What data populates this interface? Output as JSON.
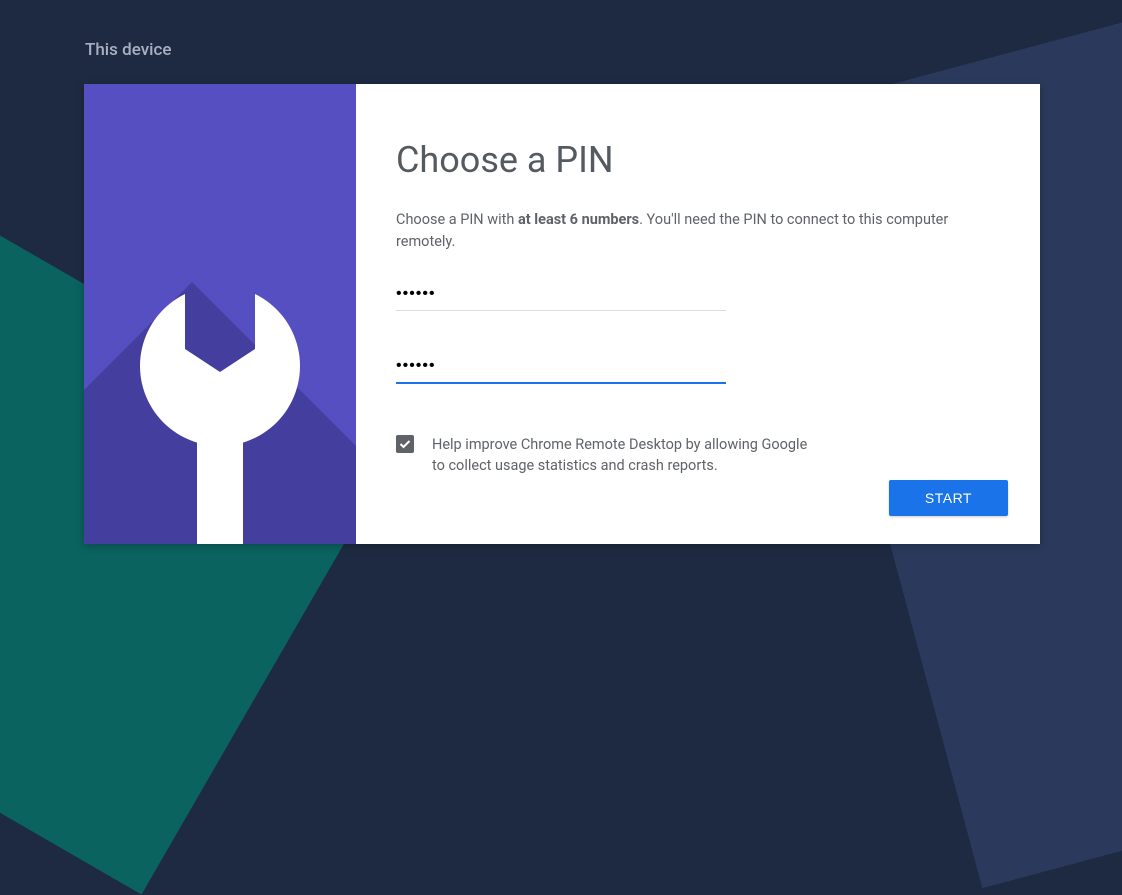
{
  "page": {
    "section_label": "This device"
  },
  "dialog": {
    "title": "Choose a PIN",
    "desc_pre": "Choose a PIN with ",
    "desc_bold": "at least 6 numbers",
    "desc_post": ". You'll need the PIN to connect to this computer remotely.",
    "pin1_value": "••••••",
    "pin2_value": "••••••",
    "checkbox_checked": true,
    "checkbox_label": "Help improve Chrome Remote Desktop by allowing Google to collect usage statistics and crash reports.",
    "start_label": "START"
  },
  "colors": {
    "bg": "#1e2a42",
    "panel_accent": "#564FC2",
    "primary_button": "#1a73e8"
  }
}
